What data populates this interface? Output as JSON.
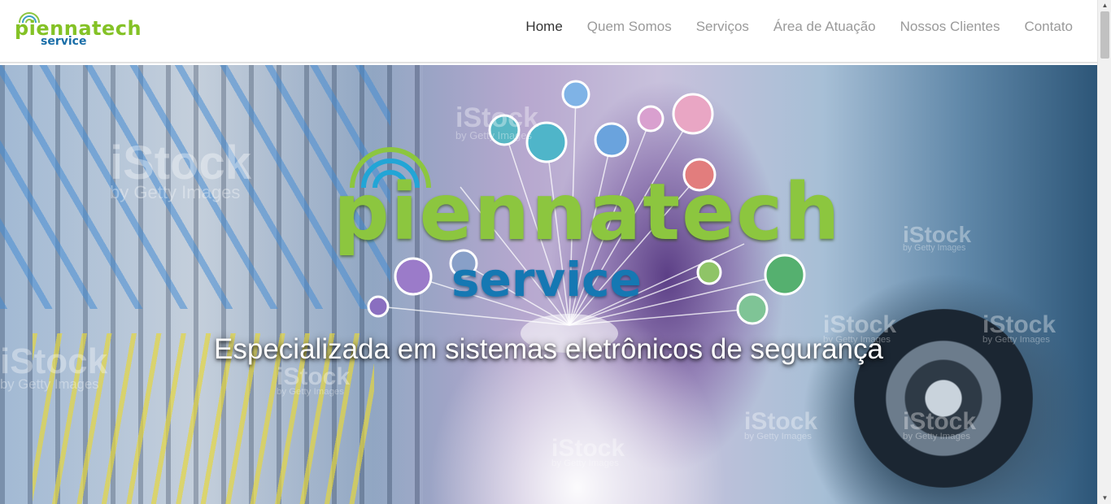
{
  "brand": {
    "name": "piennatech",
    "sub": "service"
  },
  "nav": {
    "items": [
      {
        "label": "Home",
        "active": true
      },
      {
        "label": "Quem Somos",
        "active": false
      },
      {
        "label": "Serviços",
        "active": false
      },
      {
        "label": "Área de Atuação",
        "active": false
      },
      {
        "label": "Nossos Clientes",
        "active": false
      },
      {
        "label": "Contato",
        "active": false
      }
    ]
  },
  "hero": {
    "logo_main": "piennatech",
    "logo_sub": "service",
    "tagline": "Especializada em sistemas eletrônicos de segurança"
  },
  "watermark": {
    "brand": "iStock",
    "sub": "by Getty Images"
  },
  "colors": {
    "brand_green": "#8cc63f",
    "brand_blue": "#1578b3",
    "nav_active": "#333333",
    "nav_inactive": "#9a9a9a"
  }
}
